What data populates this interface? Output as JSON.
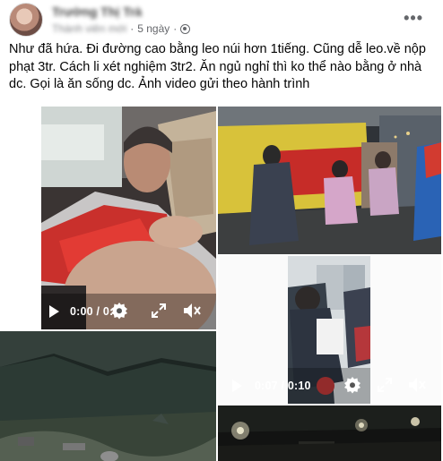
{
  "post": {
    "author": "Trường Thị Trà",
    "audience_label": "Thành viên mới",
    "time": "5 ngày",
    "text": "Như đã hứa. Đi đường cao bằng leo núi hơn 1tiếng. Cũng dễ leo.về nộp phạt 3tr. Cách li xét nghiệm 3tr2. Ăn ngủ nghỉ thì ko thể nào bằng ở nhà dc. Gọi là ăn sống dc. Ảnh video gửi theo hành trình"
  },
  "icons": {
    "globe": "globe-icon",
    "more": "more-options-icon",
    "play": "play-icon",
    "settings": "gear-icon",
    "fullscreen": "expand-icon",
    "volume": "mute-icon"
  },
  "media": [
    {
      "type": "video",
      "time": "0:00 / 0:17"
    },
    {
      "type": "photo"
    },
    {
      "type": "video",
      "time": "0:07 / 0:10"
    },
    {
      "type": "photo"
    },
    {
      "type": "photo"
    }
  ],
  "colors": {
    "meta_text": "#65676b",
    "text": "#050505"
  }
}
